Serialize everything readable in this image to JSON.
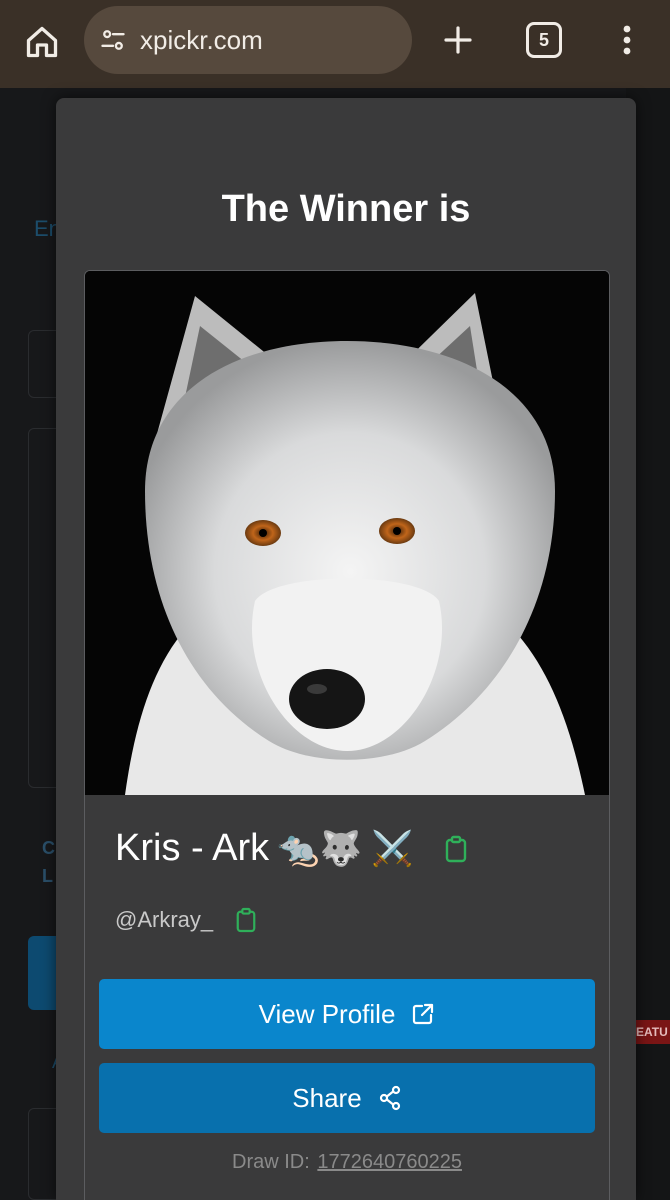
{
  "browser": {
    "url": "xpickr.com",
    "tab_count": "5"
  },
  "background": {
    "link_fragment": "En",
    "text_c": "C",
    "text_l": "L",
    "text_a": "A",
    "feature_badge": "EATU"
  },
  "modal": {
    "title": "The Winner is",
    "winner": {
      "name": "Kris - Ark",
      "emojis": "🐀🐺 ⚔️",
      "handle": "@Arkray_"
    },
    "buttons": {
      "view_profile": "View Profile",
      "share": "Share"
    },
    "draw_id_label": "Draw ID:",
    "draw_id_value": "1772640760225"
  },
  "colors": {
    "browser_bar": "#3a3027",
    "modal_bg": "#3a3a3b",
    "primary_button": "#0a86cc",
    "share_button": "#0870ad",
    "copy_icon": "#2fb05a"
  }
}
